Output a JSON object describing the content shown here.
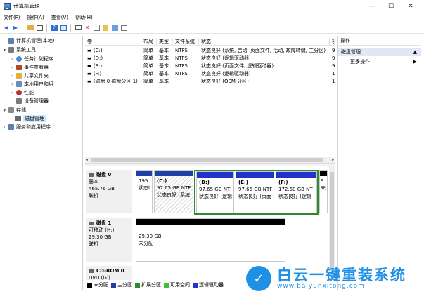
{
  "window": {
    "title": "计算机管理",
    "min": "—",
    "max": "☐",
    "close": "✕"
  },
  "menu": [
    "文件(F)",
    "操作(A)",
    "查看(V)",
    "帮助(H)"
  ],
  "tree": [
    {
      "label": "计算机管理(本地)",
      "icon": "computer-icon",
      "color": "#5a7fb0"
    },
    {
      "label": "系统工具",
      "icon": "tools-icon",
      "color": "#7a7a7a"
    },
    {
      "label": "任务计划程序",
      "icon": "clock-icon",
      "color": "#4d8bd1"
    },
    {
      "label": "事件查看器",
      "icon": "event-icon",
      "color": "#b04a2a"
    },
    {
      "label": "共享文件夹",
      "icon": "folder-icon",
      "color": "#e2b13c"
    },
    {
      "label": "本地用户和组",
      "icon": "users-icon",
      "color": "#6b8cc0"
    },
    {
      "label": "性能",
      "icon": "performance-icon",
      "color": "#c03030"
    },
    {
      "label": "设备管理器",
      "icon": "device-icon",
      "color": "#7a7a7a"
    },
    {
      "label": "存储",
      "icon": "storage-icon",
      "color": "#8a8a8a"
    },
    {
      "label": "磁盘管理",
      "icon": "disk-mgmt-icon",
      "color": "#6a6a6a"
    },
    {
      "label": "服务和应用程序",
      "icon": "services-icon",
      "color": "#5a7fb0"
    }
  ],
  "volume_table": {
    "headers": [
      "卷",
      "布局",
      "类型",
      "文件系统",
      "状态",
      "容"
    ],
    "rows": [
      [
        "(C:)",
        "简单",
        "基本",
        "NTFS",
        "状态良好 (系统, 启动, 页面文件, 活动, 故障转储, 主分区)",
        "9"
      ],
      [
        "(D:)",
        "简单",
        "基本",
        "NTFS",
        "状态良好 (逻辑驱动器)",
        "9"
      ],
      [
        "(E:)",
        "简单",
        "基本",
        "NTFS",
        "状态良好 (页面文件, 逻辑驱动器)",
        "9"
      ],
      [
        "(F:)",
        "简单",
        "基本",
        "NTFS",
        "状态良好 (逻辑驱动器)",
        "1"
      ],
      [
        "(磁盘 0 磁盘分区 1)",
        "简单",
        "基本",
        "",
        "状态良好 (OEM 分区)",
        "1"
      ]
    ]
  },
  "disks": {
    "disk0": {
      "name": "磁盘 0",
      "type": "基本",
      "size": "465.76 GB",
      "status": "联机",
      "parts": [
        {
          "line1": "",
          "line2": "195 I",
          "line3": "状态l"
        },
        {
          "line1": "(C:)",
          "line2": "97.65 GB NTF",
          "line3": "状态良好 (系统"
        },
        {
          "line1": "(D:)",
          "line2": "97.65 GB NTI",
          "line3": "状态良好 (逻辑"
        },
        {
          "line1": "(E:)",
          "line2": "97.65 GB NTF",
          "line3": "状态良好 (页面"
        },
        {
          "line1": "(F:)",
          "line2": "172.60 GB NT",
          "line3": "状态良好 (逻辑"
        },
        {
          "line1": "",
          "line2": "9",
          "line3": "未"
        }
      ]
    },
    "disk1": {
      "name": "磁盘 1",
      "type": "可移动 (H:)",
      "size": "29.30 GB",
      "status": "联机",
      "part": {
        "line1": "29.30 GB",
        "line2": "未分配"
      }
    },
    "cdrom": {
      "name": "CD-ROM 0",
      "type": "DVD (G:)"
    }
  },
  "legend": [
    {
      "label": "未分配",
      "color": "#000000"
    },
    {
      "label": "主分区",
      "color": "#1f3fa8"
    },
    {
      "label": "扩展分区",
      "color": "#2e8b2e"
    },
    {
      "label": "可用空间",
      "color": "#3fbf3f"
    },
    {
      "label": "逻辑驱动器",
      "color": "#2233cc"
    }
  ],
  "actions": {
    "header": "操作",
    "section": "磁盘管理",
    "more": "更多操作"
  },
  "watermark": {
    "cn": "白云一键重装系统",
    "url": "www.baiyunxitong.com"
  }
}
